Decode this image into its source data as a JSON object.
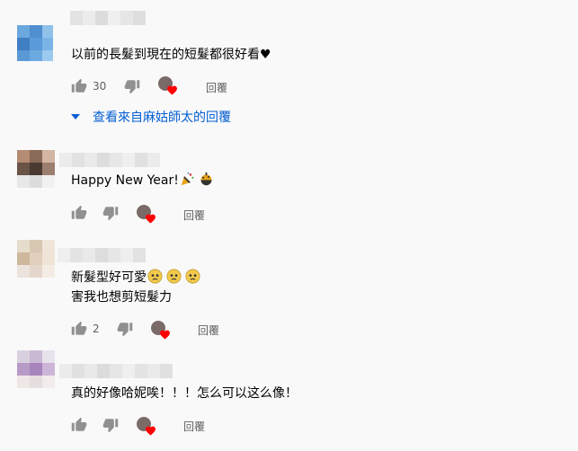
{
  "comments": [
    {
      "text": [
        "以前的長髮到現在的短髮都很好看♥"
      ],
      "likes": "30",
      "reply_label": "回覆",
      "view_replies": "查看來自麻姑師太的回覆",
      "avatar_colors": [
        "#6aa8de",
        "#4f8fd0",
        "#8fc2ea",
        "#3f7fc2",
        "#5b9ad8",
        "#7ab4e6",
        "#5a98d6",
        "#6ca9e0",
        "#9cc9ee"
      ]
    },
    {
      "text": [
        "Happy New Year!"
      ],
      "likes": "",
      "reply_label": "回覆",
      "avatar_colors": [
        "#b58b74",
        "#8a6a58",
        "#d2b6a3",
        "#6a5347",
        "#4a3a32",
        "#9b7e6e",
        "#e8e8e8",
        "#dcdcdc",
        "#f1f1f1"
      ]
    },
    {
      "text": [
        "新髮型好可愛",
        "害我也想剪短髮力"
      ],
      "likes": "2",
      "reply_label": "回覆",
      "avatar_colors": [
        "#e6dccb",
        "#d8c7b2",
        "#efe5d8",
        "#cdb79d",
        "#e2cfbb",
        "#f0e4d6",
        "#ece4dc",
        "#e4d6ca",
        "#f4ece4"
      ]
    },
    {
      "text": [
        "真的好像哈妮唉！！！怎么可以这么像！"
      ],
      "likes": "",
      "reply_label": "回覆",
      "avatar_colors": [
        "#d9d0df",
        "#c9b9d3",
        "#e8e2ec",
        "#b89ac7",
        "#a884bd",
        "#cdb5d8",
        "#efe6e6",
        "#e6dede",
        "#f2ecec"
      ]
    }
  ]
}
